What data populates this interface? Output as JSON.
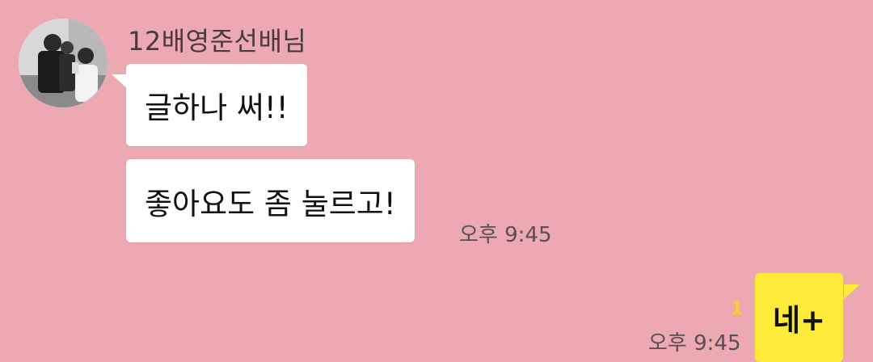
{
  "chat": {
    "sender_name": "12배영준선배님",
    "messages": [
      {
        "text": "글하나 써!!"
      },
      {
        "text": "좋아요도 좀 눌르고!",
        "time": "오후 9:45"
      }
    ],
    "my_message": {
      "text": "네+",
      "unread_count": "1",
      "time": "오후 9:45"
    }
  },
  "colors": {
    "background": "#ECA9B2",
    "incoming_bubble": "#FFFFFF",
    "outgoing_bubble": "#FEEB3A",
    "unread_badge": "#F5D02E"
  }
}
